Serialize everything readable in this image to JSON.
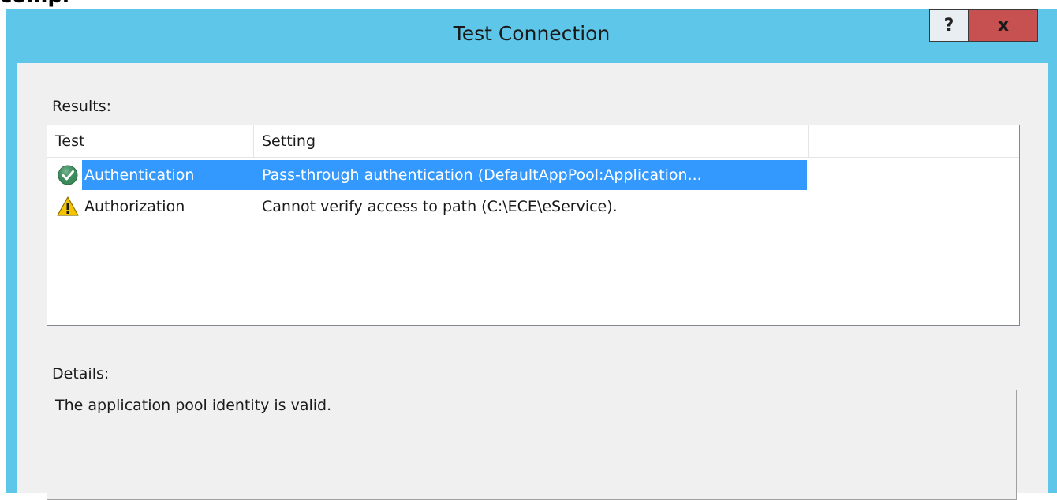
{
  "page_fragment": "comple",
  "window": {
    "title": "Test Connection",
    "help_label": "?",
    "close_label": "x"
  },
  "results": {
    "label": "Results:",
    "columns": [
      "Test",
      "Setting"
    ],
    "rows": [
      {
        "icon": "check-success-icon",
        "test": "Authentication",
        "setting": "Pass-through authentication (DefaultAppPool:Application...",
        "selected": true
      },
      {
        "icon": "warning-icon",
        "test": "Authorization",
        "setting": "Cannot verify access to path (C:\\ECE\\eService).",
        "selected": false
      }
    ]
  },
  "details": {
    "label": "Details:",
    "text": "The application pool identity is valid."
  },
  "colors": {
    "titlebar": "#5ec6e8",
    "selection": "#3399ff",
    "close_button": "#c75050",
    "success": "#3a8a5a",
    "warning": "#f5c400"
  }
}
